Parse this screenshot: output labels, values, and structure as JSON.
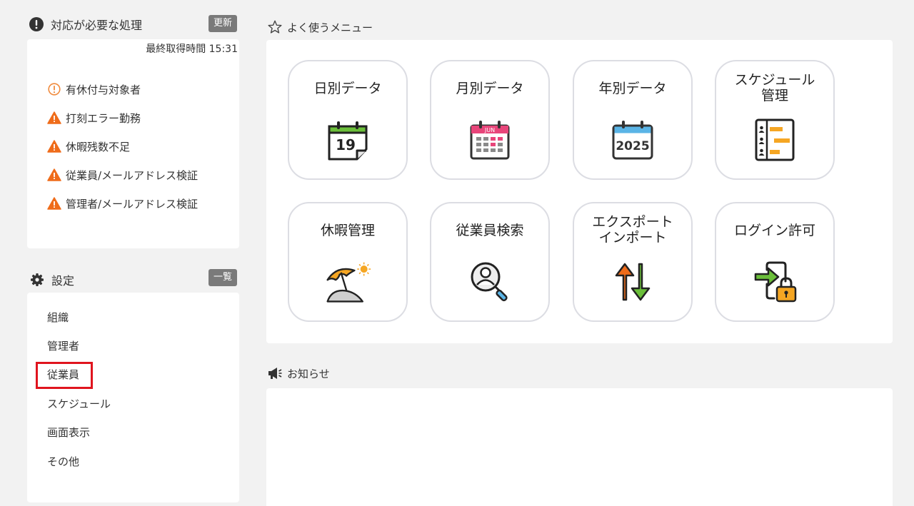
{
  "alerts_section": {
    "title": "対応が必要な処理",
    "refresh_label": "更新",
    "last_fetched": "最終取得時間 15:31",
    "items": [
      {
        "label": "有休付与対象者",
        "icon": "info-circle-icon"
      },
      {
        "label": "打刻エラー勤務",
        "icon": "warning-icon"
      },
      {
        "label": "休暇残数不足",
        "icon": "warning-icon"
      },
      {
        "label": "従業員/メールアドレス検証",
        "icon": "warning-icon"
      },
      {
        "label": "管理者/メールアドレス検証",
        "icon": "warning-icon"
      }
    ]
  },
  "settings_section": {
    "title": "設定",
    "list_label": "一覧",
    "items": [
      "組織",
      "管理者",
      "従業員",
      "スケジュール",
      "画面表示",
      "その他"
    ],
    "highlighted_item": "従業員"
  },
  "favorites": {
    "title": "よく使うメニュー",
    "tiles": [
      {
        "label": "日別データ",
        "icon": "calendar-day-icon",
        "icon_text": "19"
      },
      {
        "label": "月別データ",
        "icon": "calendar-month-icon",
        "icon_text": "JUN"
      },
      {
        "label": "年別データ",
        "icon": "calendar-year-icon",
        "icon_text": "2025"
      },
      {
        "label_line1": "スケジュール",
        "label_line2": "管理",
        "icon": "schedule-icon"
      },
      {
        "label": "休暇管理",
        "icon": "vacation-icon"
      },
      {
        "label": "従業員検索",
        "icon": "employee-search-icon"
      },
      {
        "label_line1": "エクスポート",
        "label_line2": "インポート",
        "icon": "export-import-icon"
      },
      {
        "label": "ログイン許可",
        "icon": "login-permission-icon"
      }
    ]
  },
  "news": {
    "title": "お知らせ"
  },
  "colors": {
    "warning": "#ef6c1a",
    "info": "#f08a3c",
    "highlight": "#e0141e",
    "button_gray": "#7a7a7a",
    "calendar_green": "#6bbf3a",
    "calendar_pink": "#e8457a",
    "calendar_blue": "#5ab4e6",
    "schedule_orange": "#f5a623"
  }
}
